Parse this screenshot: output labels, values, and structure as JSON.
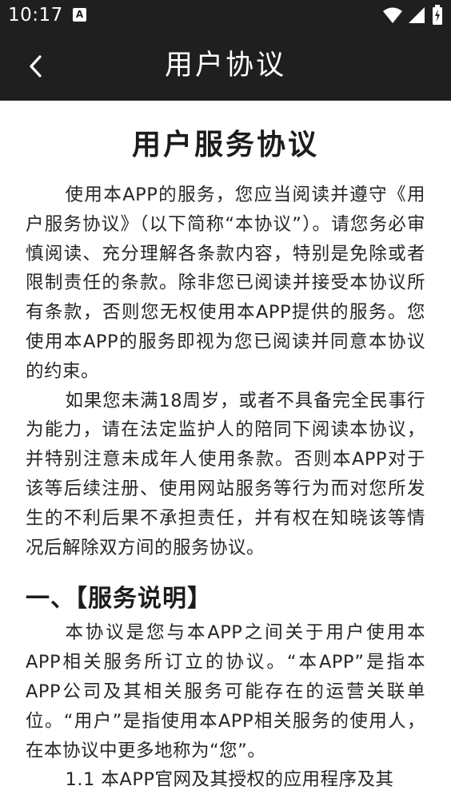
{
  "status_bar": {
    "time": "10:17",
    "app_icon_letter": "A",
    "icons": [
      "wifi-icon",
      "signal-icon",
      "battery-icon"
    ]
  },
  "app_bar": {
    "back_icon": "chevron-left-icon",
    "title": "用户协议"
  },
  "document": {
    "title": "用户服务协议",
    "intro_paragraphs": [
      "使用本APP的服务，您应当阅读并遵守《用户服务协议》（以下简称“本协议”）。请您务必审慎阅读、充分理解各条款内容，特别是免除或者限制责任的条款。除非您已阅读并接受本协议所有条款，否则您无权使用本APP提供的服务。您使用本APP的服务即视为您已阅读并同意本协议的约束。",
      "如果您未满18周岁，或者不具备完全民事行为能力，请在法定监护人的陪同下阅读本协议，并特别注意未成年人使用条款。否则本APP对于该等后续注册、使用网站服务等行为而对您所发生的不利后果不承担责任，并有权在知晓该等情况后解除双方间的服务协议。"
    ],
    "section_1": {
      "heading": "一、【服务说明】",
      "paragraphs": [
        "本协议是您与本APP之间关于用户使用本APP相关服务所订立的协议。“本APP”是指本APP公司及其相关服务可能存在的运营关联单位。“用户”是指使用本APP相关服务的使用人，在本协议中更多地称为“您”。",
        "1.1 本APP官网及其授权的应用程序及其"
      ]
    }
  },
  "colors": {
    "bar_background": "#1f1f1f",
    "page_background": "#ffffff",
    "text": "#262626"
  }
}
